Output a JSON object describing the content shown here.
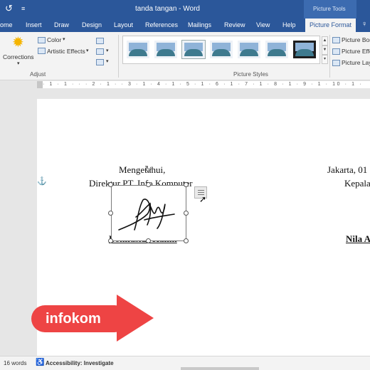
{
  "window": {
    "title": "tanda tangan  -  Word",
    "contextual_tab_group": "Picture Tools"
  },
  "tabs": [
    {
      "label": "ome",
      "active": false
    },
    {
      "label": "Insert",
      "active": false
    },
    {
      "label": "Draw",
      "active": false
    },
    {
      "label": "Design",
      "active": false
    },
    {
      "label": "Layout",
      "active": false
    },
    {
      "label": "References",
      "active": false
    },
    {
      "label": "Mailings",
      "active": false
    },
    {
      "label": "Review",
      "active": false
    },
    {
      "label": "View",
      "active": false
    },
    {
      "label": "Help",
      "active": false
    },
    {
      "label": "Picture Format",
      "active": true
    }
  ],
  "ribbon": {
    "adjust": {
      "corrections_label": "Corrections",
      "color_label": "Color",
      "artistic_effects_label": "Artistic Effects",
      "group_label": "Adjust"
    },
    "picture_styles": {
      "group_label": "Picture Styles",
      "style_count": 7,
      "selected_index": 2,
      "side_items": [
        "Picture Bor",
        "Picture Effe",
        "Picture Lay"
      ]
    }
  },
  "ruler": {
    "marks": "· 1 · 1 · · · 2 · 1 · · 3 · 1 · 4 · 1 · 5 · 1 · 6 · 1 · 7 · 1 · 8 · 1 · 9 · 1 · 10 · 1 ·"
  },
  "document": {
    "left_block": {
      "line1": "Mengetahui,",
      "line2": "Direktur PT. Info Komputer",
      "signer": "Bonifasius Halim"
    },
    "right_block": {
      "line1": "Jakarta, 01",
      "line2": "Kepala",
      "signer": "Nila A"
    },
    "signature_image_name": "handwritten-signature"
  },
  "watermark": {
    "text": "infokom",
    "color": "#ee4444"
  },
  "statusbar": {
    "word_count": "16 words",
    "accessibility": "Accessibility: Investigate"
  },
  "colors": {
    "word_blue": "#2b579a",
    "ribbon_bg": "#f3f3f3"
  }
}
